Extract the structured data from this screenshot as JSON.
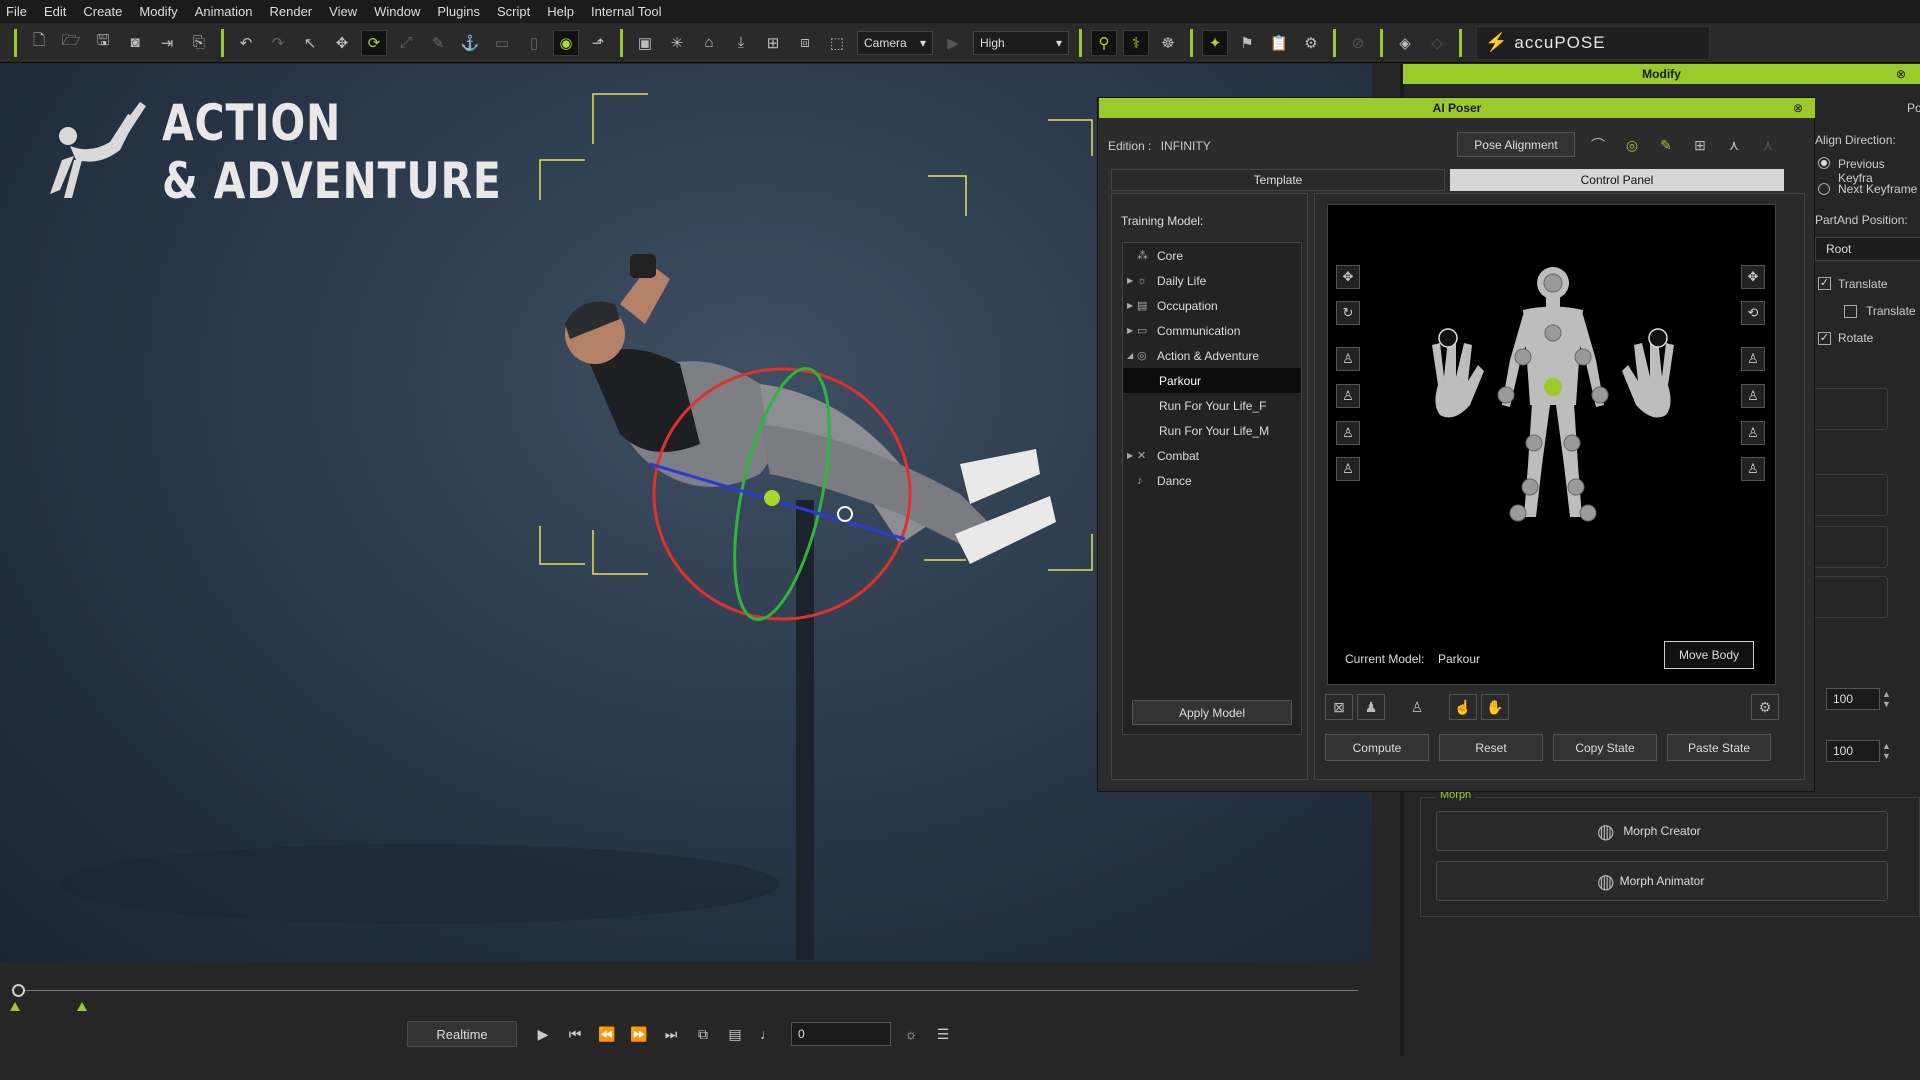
{
  "menu": [
    "File",
    "Edit",
    "Create",
    "Modify",
    "Animation",
    "Render",
    "View",
    "Window",
    "Plugins",
    "Script",
    "Help",
    "Internal Tool"
  ],
  "toolbar": {
    "camera_label": "Camera",
    "quality_label": "High",
    "brand": "accuPOSE"
  },
  "viewport": {
    "title_line1": "ACTION",
    "title_line2": "& ADVENTURE"
  },
  "timeline": {
    "realtime_label": "Realtime",
    "frame_value": "0"
  },
  "modify_panel": {
    "title": "Modify",
    "align_direction_label": "Align Direction:",
    "prev_keyframe": "Previous Keyfra",
    "next_keyframe": "Next Keyframe",
    "part_position_label": "PartAnd Position:",
    "part_value": "Root",
    "translate_label": "Translate",
    "translate2_label": "Translate",
    "rotate_label": "Rotate",
    "spin1": "100",
    "spin2": "100",
    "morph_section": "Morph",
    "morph_creator": "Morph Creator",
    "morph_animator": "Morph Animator",
    "partial_tab": "Po"
  },
  "ai_poser": {
    "title": "AI Poser",
    "edition_label": "Edition :",
    "edition_value": "INFINITY",
    "pose_alignment": "Pose Alignment",
    "tab_template": "Template",
    "tab_control_panel": "Control Panel",
    "training_model_label": "Training Model:",
    "tree": [
      {
        "label": "Core",
        "icon": "core-icon",
        "level": 0,
        "arrow": ""
      },
      {
        "label": "Daily Life",
        "icon": "sun-icon",
        "level": 0,
        "arrow": "▶"
      },
      {
        "label": "Occupation",
        "icon": "briefcase-icon",
        "level": 0,
        "arrow": "▶"
      },
      {
        "label": "Communication",
        "icon": "chat-icon",
        "level": 0,
        "arrow": "▶"
      },
      {
        "label": "Action & Adventure",
        "icon": "compass-icon",
        "level": 0,
        "arrow": "◢"
      },
      {
        "label": "Parkour",
        "icon": "",
        "level": 1,
        "arrow": ""
      },
      {
        "label": "Run For Your Life_F",
        "icon": "",
        "level": 1,
        "arrow": ""
      },
      {
        "label": "Run For Your Life_M",
        "icon": "",
        "level": 1,
        "arrow": ""
      },
      {
        "label": "Combat",
        "icon": "swords-icon",
        "level": 0,
        "arrow": "▶"
      },
      {
        "label": "Dance",
        "icon": "dance-icon",
        "level": 0,
        "arrow": ""
      }
    ],
    "selected_item": "Parkour",
    "apply_model": "Apply Model",
    "current_model_label": "Current Model:",
    "current_model_value": "Parkour",
    "move_body": "Move Body",
    "compute": "Compute",
    "reset": "Reset",
    "copy_state": "Copy State",
    "paste_state": "Paste State"
  },
  "colors": {
    "accent": "#9acb2a",
    "panel_bg": "#2c2c2c",
    "viewport_bg": "#2b394b"
  }
}
